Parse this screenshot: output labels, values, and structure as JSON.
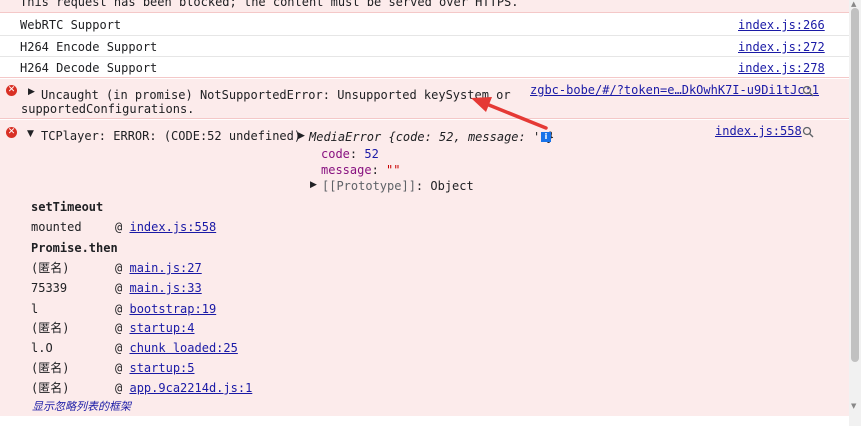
{
  "blocked_message": "This request has been blocked; the content must be served over HTTPS.",
  "info_rows": [
    {
      "text": "WebRTC Support",
      "link": "index.js:266"
    },
    {
      "text": "H264 Encode Support",
      "link": "index.js:272"
    },
    {
      "text": "H264 Decode Support",
      "link": "index.js:278"
    }
  ],
  "uncaught": {
    "line1": "Uncaught (in promise) NotSupportedError: Unsupported keySystem or",
    "line2": "supportedConfigurations.",
    "link": "zgbc-bobe/#/?token=e…DkOwhK7I-u9Di1tJc:1"
  },
  "tcplayer": {
    "message": "TCPlayer: ERROR: (CODE:52 undefined)",
    "obj_preview": "MediaError {code: 52, message: ''}",
    "info_badge": "i",
    "code_key": "code",
    "code_value": "52",
    "message_key": "message",
    "message_value": "\"\"",
    "prototype_key": "[[Prototype]]",
    "prototype_value": "Object",
    "link": "index.js:558"
  },
  "stack": [
    {
      "fn": "setTimeout",
      "bold": true,
      "at": "",
      "loc": ""
    },
    {
      "fn": "mounted",
      "bold": false,
      "at": "@",
      "loc": "index.js:558"
    },
    {
      "fn": "Promise.then",
      "bold": true,
      "at": "",
      "loc": ""
    },
    {
      "fn": "(匿名)",
      "bold": false,
      "at": "@",
      "loc": "main.js:27"
    },
    {
      "fn": "75339",
      "bold": false,
      "at": "@",
      "loc": "main.js:33"
    },
    {
      "fn": "l",
      "bold": false,
      "at": "@",
      "loc": "bootstrap:19"
    },
    {
      "fn": "(匿名)",
      "bold": false,
      "at": "@",
      "loc": "startup:4"
    },
    {
      "fn": "l.O",
      "bold": false,
      "at": "@",
      "loc": "chunk loaded:25"
    },
    {
      "fn": "(匿名)",
      "bold": false,
      "at": "@",
      "loc": "startup:5"
    },
    {
      "fn": "(匿名)",
      "bold": false,
      "at": "@",
      "loc": "app.9ca2214d.js:1"
    }
  ],
  "show_ignored": "显示忽略列表的框架",
  "colors": {
    "error_bg": "#fcebeb",
    "link": "#1a1aa6",
    "arrow": "#e53935",
    "error_icon": "#d93025"
  }
}
